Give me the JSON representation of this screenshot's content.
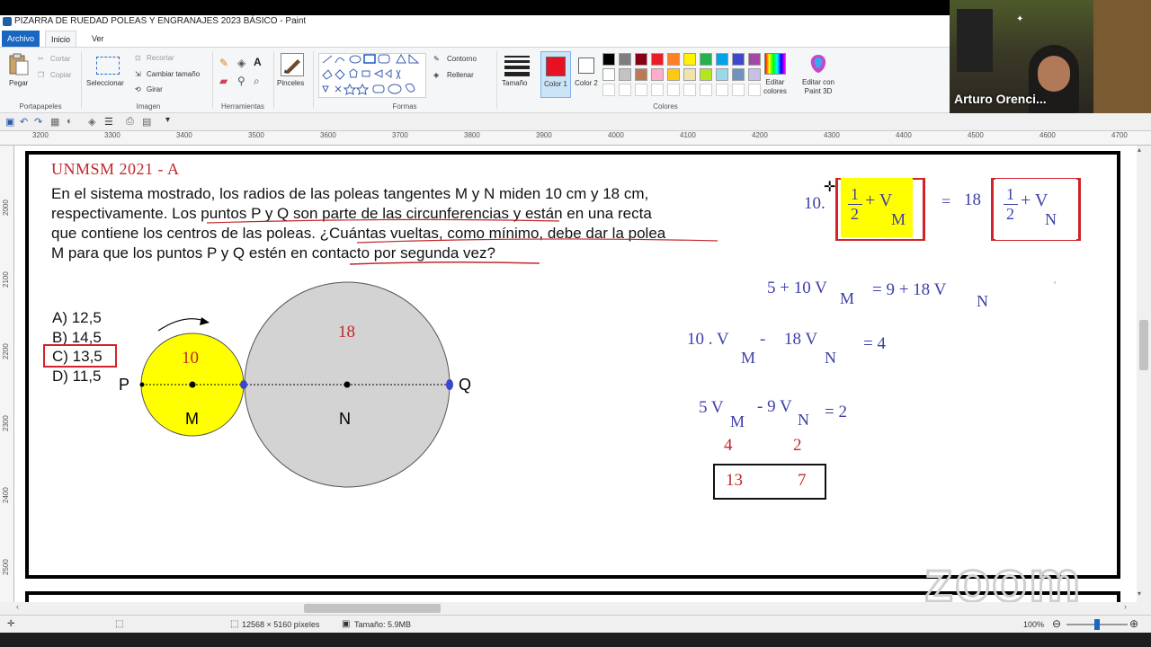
{
  "window": {
    "title": "PIZARRA DE RUEDAD POLEAS  Y ENGRANAJES 2023 BÁSICO - Paint"
  },
  "menu": {
    "tabs": [
      "Archivo",
      "Inicio",
      "Ver"
    ]
  },
  "ribbon": {
    "portapapeles": {
      "paste": "Pegar",
      "cut": "Cortar",
      "copy": "Copiar",
      "label": "Portapapeles"
    },
    "imagen": {
      "select": "Seleccionar",
      "crop": "Recortar",
      "resize": "Cambiar tamaño",
      "rotate": "Girar",
      "label": "Imagen"
    },
    "herramientas": {
      "label": "Herramientas"
    },
    "pinceles": {
      "label": "Pinceles"
    },
    "formas": {
      "outline": "Contorno",
      "fill": "Rellenar",
      "label": "Formas"
    },
    "tamano": {
      "label": "Tamaño"
    },
    "color1": {
      "label": "Color 1",
      "value": "#e81123"
    },
    "color2": {
      "label": "Color 2",
      "value": "#ffffff"
    },
    "colores": {
      "label": "Colores",
      "edit": "Editar colores",
      "paint3d": "Editar con Paint 3D"
    },
    "palette_row1": [
      "#000000",
      "#7f7f7f",
      "#880015",
      "#ed1c24",
      "#ff7f27",
      "#fff200",
      "#22b14c",
      "#00a2e8",
      "#3f48cc",
      "#a349a4"
    ],
    "palette_row2": [
      "#ffffff",
      "#c3c3c3",
      "#b97a57",
      "#ffaec9",
      "#ffc90e",
      "#efe4b0",
      "#b5e61d",
      "#99d9ea",
      "#7092be",
      "#c8bfe7"
    ]
  },
  "video": {
    "participant_name": "Arturo Orenci..."
  },
  "ruler": {
    "h_ticks": [
      "3200",
      "3300",
      "3400",
      "3500",
      "3600",
      "3700",
      "3800",
      "3900",
      "4000",
      "4100",
      "4200",
      "4300",
      "4400",
      "4500",
      "4600",
      "4700"
    ],
    "v_ticks": [
      "2000",
      "2100",
      "2200",
      "2300",
      "2400",
      "2500"
    ]
  },
  "problem": {
    "title": "UNMSM 2021 - A",
    "lines": [
      "En el sistema mostrado, los radios de las poleas tangentes M y N miden 10 cm y 18 cm,",
      "respectivamente. Los puntos P y Q son parte de las circunferencias y están en una recta",
      "que contiene los centros de las poleas. ¿Cuántas vueltas, como mínimo, debe dar la polea",
      "M para que los puntos P y Q estén en contacto por segunda vez?"
    ],
    "options": [
      "A) 12,5",
      "B) 14,5",
      "C) 13,5",
      "D) 11,5"
    ],
    "selected_option": "C) 13,5"
  },
  "diagram": {
    "pulley_m": {
      "label": "M",
      "radius_label": "10",
      "color": "#ffff00"
    },
    "pulley_n": {
      "label": "N",
      "radius_label": "18",
      "color": "#d3d3d3"
    },
    "point_p": "P",
    "point_q": "Q"
  },
  "work": {
    "eq1_left_coef": "10.",
    "eq1_frac_num": "1",
    "eq1_frac_den": "2",
    "eq1_plus_v": "+ V",
    "eq1_sub_m": "M",
    "eq1_equals": "=",
    "eq1_right_coef": "18",
    "eq1_sub_n": "N",
    "eq2": "5 + 10 V",
    "eq2_sub_m": "M",
    "eq2_mid": "=  9  + 18 V",
    "eq2_sub_n": "N",
    "eq3_a": "10 .  V",
    "eq3_sub_m": "M",
    "eq3_minus": "-",
    "eq3_b": "18  V",
    "eq3_sub_n": "N",
    "eq3_result": "= 4",
    "eq4_a": "5 V",
    "eq4_sub_m": "M",
    "eq4_b": "- 9 V",
    "eq4_sub_n": "N",
    "eq4_result": "= 2",
    "sol_m": "4",
    "sol_n": "2",
    "box_m": "13",
    "box_n": "7"
  },
  "status": {
    "dimensions": "12568 × 5160 píxeles",
    "size": "Tamaño: 5.9MB",
    "zoom": "100%"
  },
  "watermark": "zoom"
}
